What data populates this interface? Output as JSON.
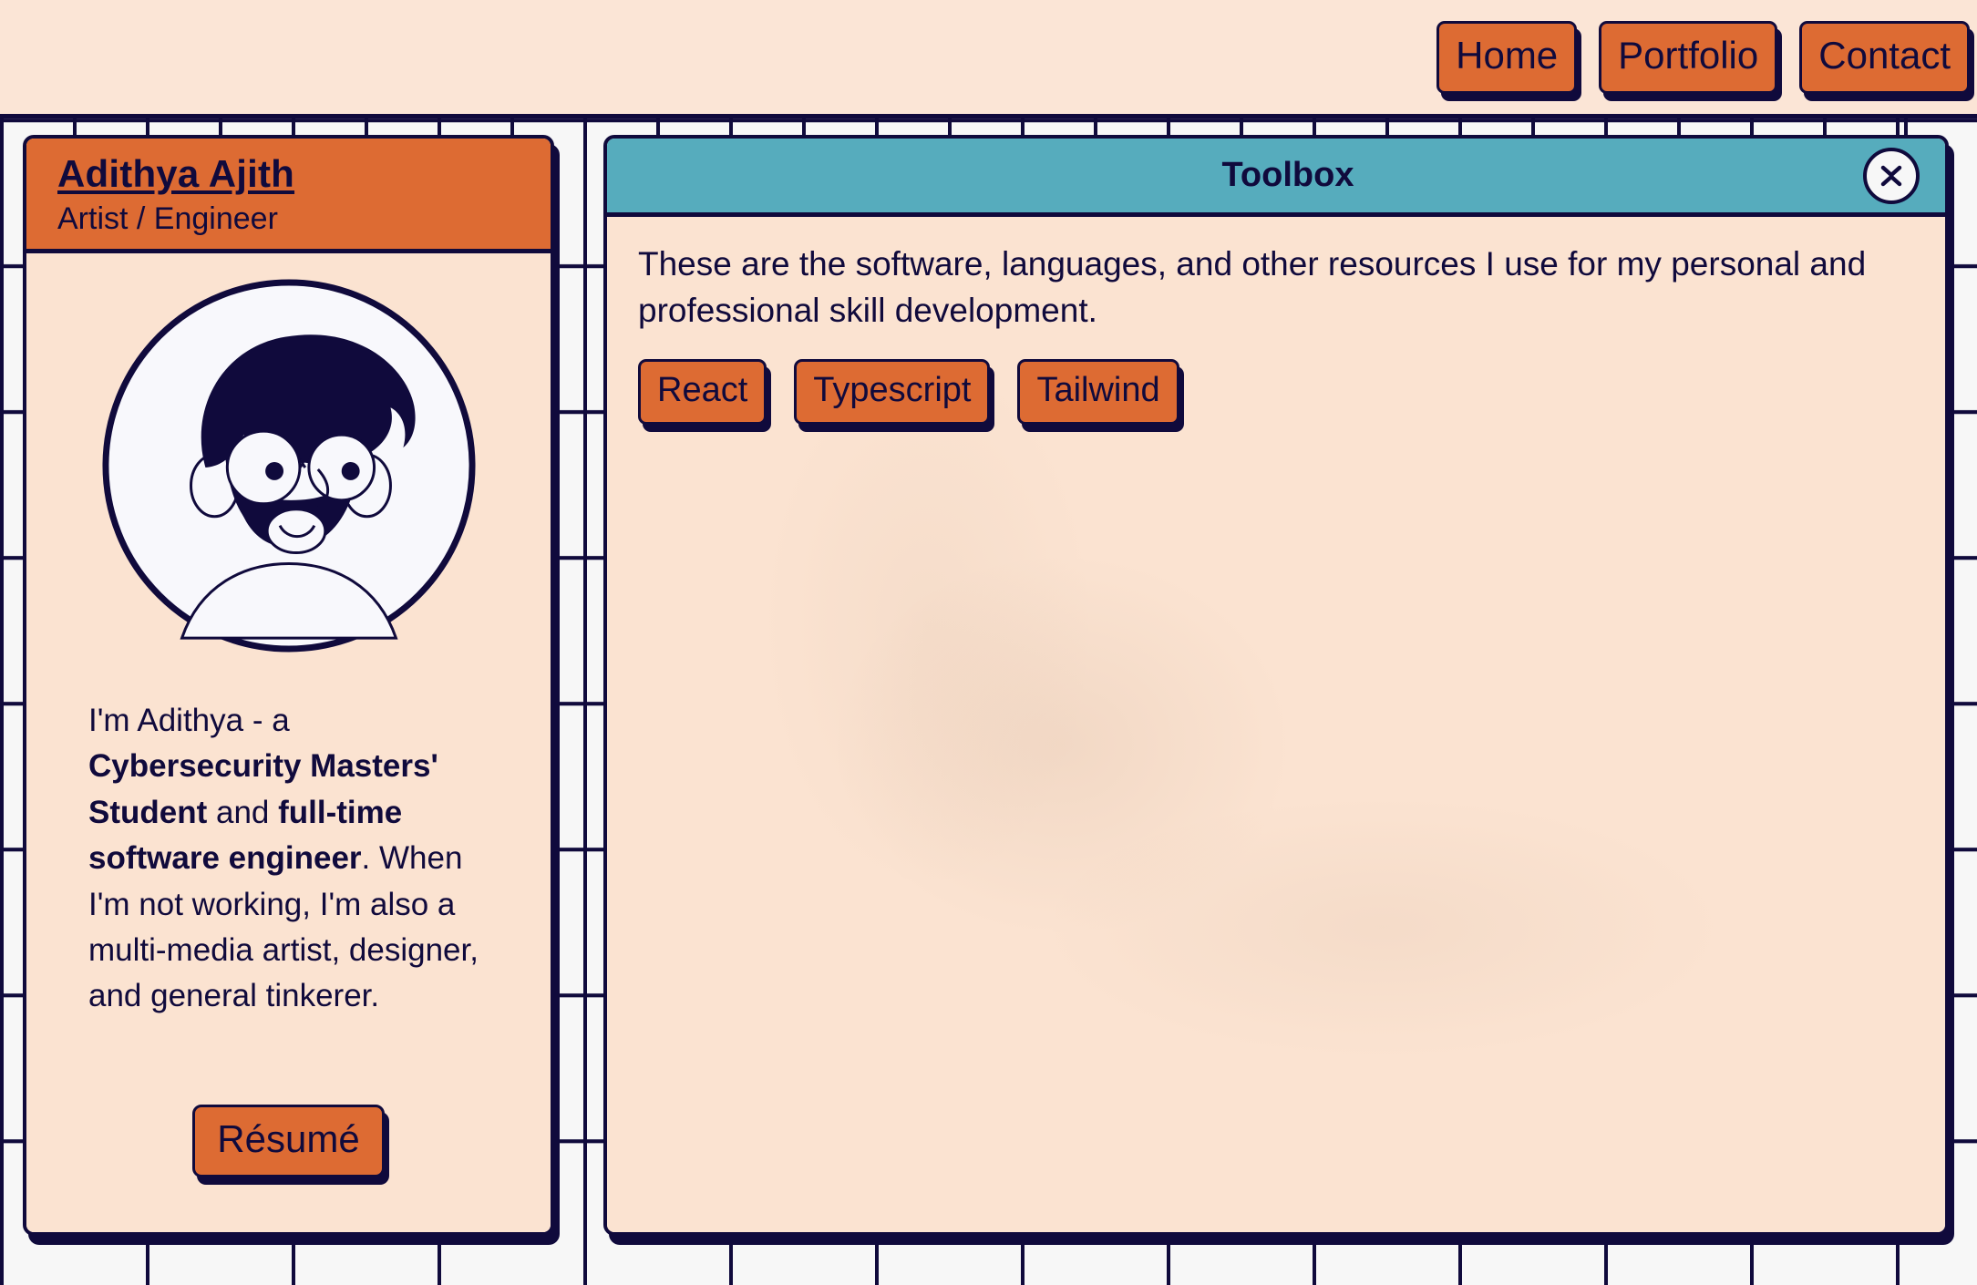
{
  "theme": {
    "navy": "#100a3c",
    "orange": "#dd6b33",
    "peach": "#fbe3d1",
    "nav_bg": "#fbe5d6",
    "teal": "#56acbd",
    "grid_bg": "#f7f7f7"
  },
  "topnav": {
    "buttons": [
      {
        "label": "Home",
        "name": "nav-home-button"
      },
      {
        "label": "Portfolio",
        "name": "nav-portfolio-button"
      },
      {
        "label": "Contact",
        "name": "nav-contact-button"
      }
    ]
  },
  "profile_card": {
    "name": "Adithya Ajith",
    "role": "Artist / Engineer",
    "avatar_icon": "avatar-illustration-icon",
    "bio_parts": [
      {
        "text": "I'm Adithya - a ",
        "bold": false
      },
      {
        "text": "Cybersecurity Masters' Student",
        "bold": true
      },
      {
        "text": " and ",
        "bold": false
      },
      {
        "text": "full-time software engineer",
        "bold": true
      },
      {
        "text": ". When I'm not working, I'm also a multi-media artist, designer, and general tinkerer.",
        "bold": false
      }
    ],
    "bio_plain": "I'm Adithya - a Cybersecurity Masters' Student and full-time software engineer. When I'm not working, I'm also a multi-media artist, designer, and general tinkerer.",
    "resume_label": "Résumé"
  },
  "toolbox": {
    "title": "Toolbox",
    "collapse_icon": "collapse-chevrons-icon",
    "description": "These are the software, languages, and other resources I use for my personal and professional skill development.",
    "skills": [
      {
        "label": "React",
        "name": "skill-react-button"
      },
      {
        "label": "Typescript",
        "name": "skill-typescript-button"
      },
      {
        "label": "Tailwind",
        "name": "skill-tailwind-button"
      }
    ]
  }
}
